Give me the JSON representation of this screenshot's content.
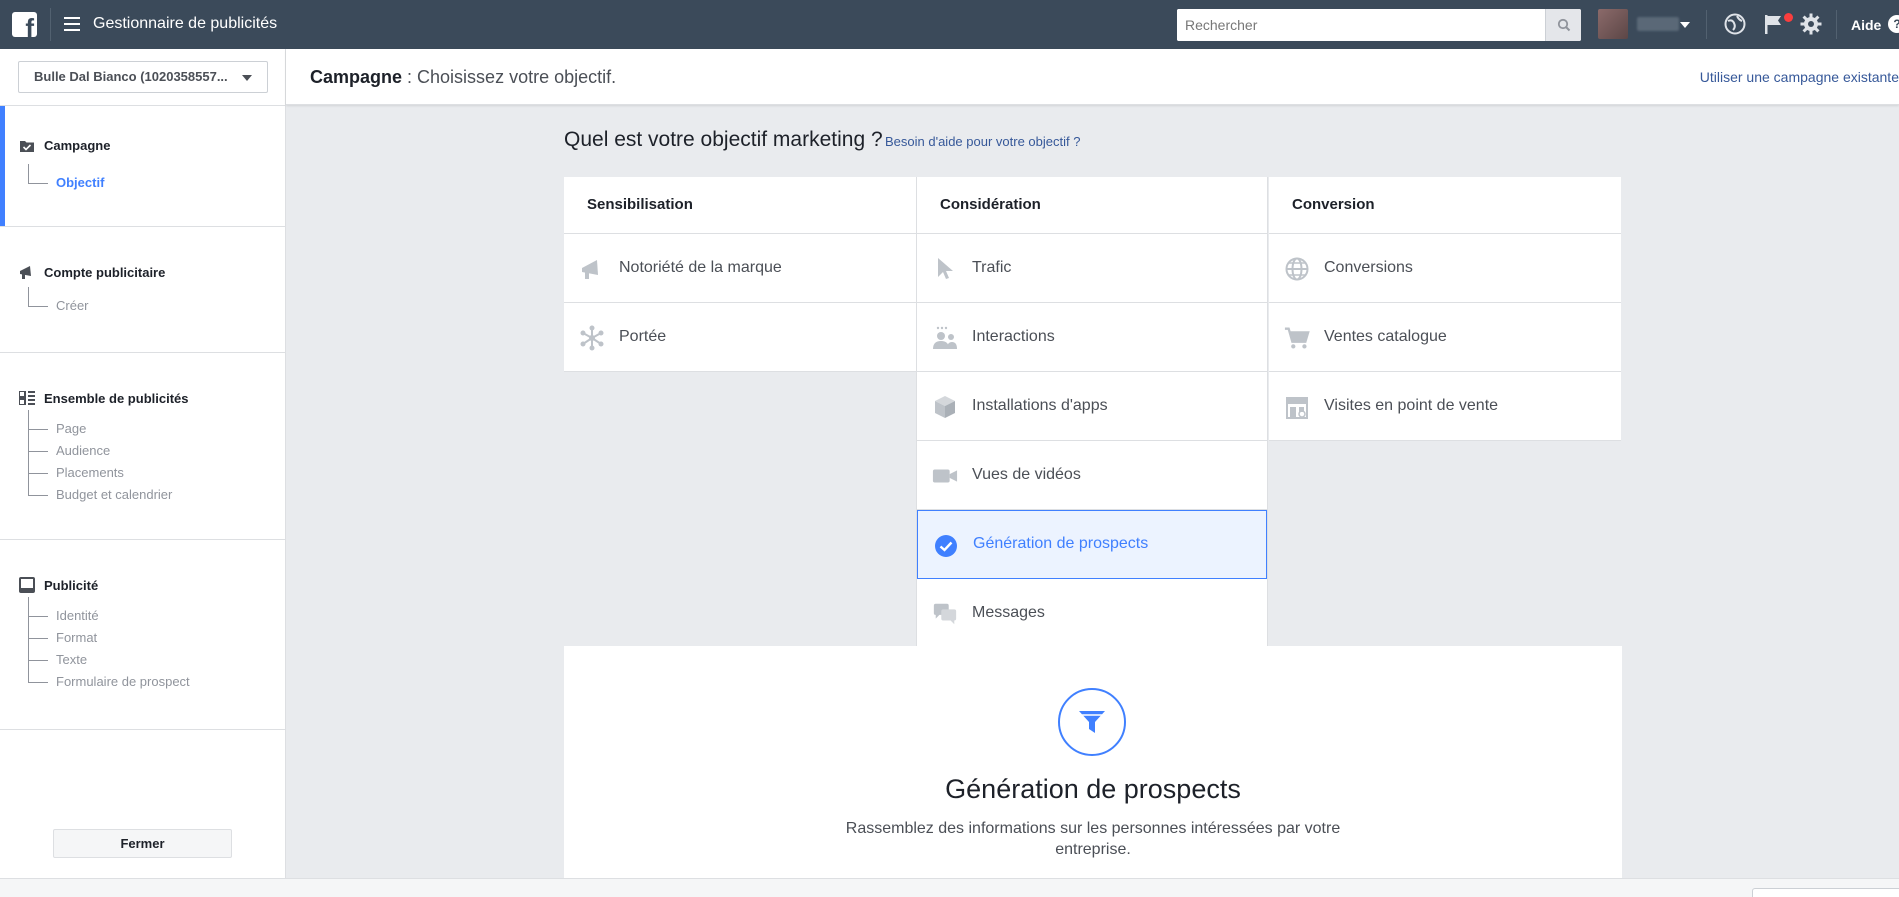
{
  "topbar": {
    "app_title": "Gestionnaire de publicités",
    "search_placeholder": "Rechercher",
    "help_label": "Aide",
    "help_q": "?"
  },
  "sidebar": {
    "account_name": "Bulle Dal Bianco (1020358557...",
    "sections": [
      {
        "title": "Campagne",
        "items": [
          "Objectif"
        ]
      },
      {
        "title": "Compte publicitaire",
        "items": [
          "Créer"
        ]
      },
      {
        "title": "Ensemble de publicités",
        "items": [
          "Page",
          "Audience",
          "Placements",
          "Budget et calendrier"
        ]
      },
      {
        "title": "Publicité",
        "items": [
          "Identité",
          "Format",
          "Texte",
          "Formulaire de prospect"
        ]
      }
    ],
    "close_label": "Fermer"
  },
  "header": {
    "title_bold": "Campagne",
    "title_rest": " : Choisissez votre objectif.",
    "existing_link": "Utiliser une campagne existante"
  },
  "main": {
    "question": "Quel est votre objectif marketing ?",
    "help_link": "Besoin d'aide pour votre objectif ?",
    "columns": [
      {
        "title": "Sensibilisation",
        "items": [
          "Notoriété de la marque",
          "Portée"
        ]
      },
      {
        "title": "Considération",
        "items": [
          "Trafic",
          "Interactions",
          "Installations d'apps",
          "Vues de vidéos",
          "Génération de prospects",
          "Messages"
        ]
      },
      {
        "title": "Conversion",
        "items": [
          "Conversions",
          "Ventes catalogue",
          "Visites en point de vente"
        ]
      }
    ],
    "selected": "Génération de prospects",
    "detail": {
      "title": "Génération de prospects",
      "description": "Rassemblez des informations sur les personnes intéressées par votre entreprise."
    }
  },
  "colors": {
    "topbar": "#3b4a5a",
    "accent": "#4080ff",
    "link": "#365899",
    "icon_muted": "#bec3c9"
  }
}
